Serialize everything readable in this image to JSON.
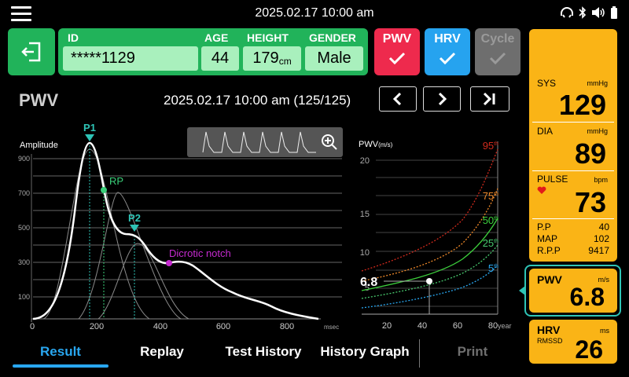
{
  "top_bar": {
    "datetime": "2025.02.17  10:00 am"
  },
  "patient": {
    "id_label": "ID",
    "id_value": "*****1129",
    "age_label": "AGE",
    "age_value": "44",
    "height_label": "HEIGHT",
    "height_value": "179",
    "height_unit": "cm",
    "gender_label": "GENDER",
    "gender_value": "Male"
  },
  "modes": [
    {
      "label": "PWV",
      "color": "#ee2a4d",
      "enabled": true
    },
    {
      "label": "HRV",
      "color": "#26a3ef",
      "enabled": true
    },
    {
      "label": "Cycle",
      "color": "#6e6e6e",
      "enabled": false
    }
  ],
  "section_title": "PWV",
  "record_info": "2025.02.17 10:00 am (125/125)",
  "waveform": {
    "ylabel": "Amplitude",
    "yticks": [
      "900",
      "700",
      "500",
      "300",
      "100"
    ],
    "xticks": [
      "0",
      "200",
      "400",
      "600",
      "800"
    ],
    "xunit": "msec",
    "annotations": {
      "p1": "P1",
      "rp": "RP",
      "p2": "P2",
      "notch": "Dicrotic notch"
    }
  },
  "pwv_chart": {
    "ylabel": "PWV",
    "yunit": "(m/s)",
    "yticks": [
      "20",
      "15",
      "10",
      "5"
    ],
    "xticks": [
      "20",
      "40",
      "60",
      "80"
    ],
    "xunit": "year",
    "percentiles": [
      {
        "label": "95",
        "color": "#d02a1c"
      },
      {
        "label": "75",
        "color": "#f08a2a"
      },
      {
        "label": "50",
        "color": "#3ccf3c"
      },
      {
        "label": "25",
        "color": "#47c96d"
      },
      {
        "label": "5",
        "color": "#29a7f0"
      }
    ],
    "current_value": "6.8"
  },
  "vitals": {
    "sys": {
      "label": "SYS",
      "unit": "mmHg",
      "value": "129"
    },
    "dia": {
      "label": "DIA",
      "unit": "mmHg",
      "value": "89"
    },
    "pulse": {
      "label": "PULSE",
      "unit": "bpm",
      "value": "73"
    },
    "pp": {
      "label": "P.P",
      "value": "40"
    },
    "map": {
      "label": "MAP",
      "value": "102"
    },
    "rpp": {
      "label": "R.P.P",
      "value": "9417"
    }
  },
  "pwv_result": {
    "label": "PWV",
    "unit": "m/s",
    "value": "6.8"
  },
  "hrv_result": {
    "label": "HRV",
    "sublabel": "RMSSD",
    "unit": "ms",
    "value": "26"
  },
  "tabs": [
    "Result",
    "Replay",
    "Test History",
    "History Graph",
    "Print"
  ],
  "colors": {
    "green": "#21b35a",
    "yellow": "#fab416",
    "teal": "#2ec4b6",
    "accent_blue": "#29a7f0"
  }
}
